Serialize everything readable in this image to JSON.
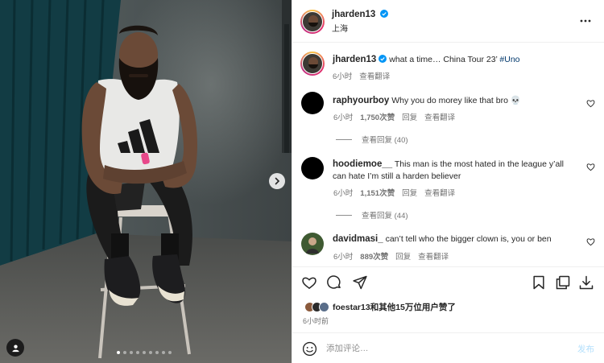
{
  "post": {
    "author": "jharden13",
    "location": "上海",
    "more_icon": "more-horizontal-icon",
    "caption_text": "what a time… China Tour 23’",
    "caption_hashtag": "#Uno",
    "caption_time": "6小时",
    "caption_translate": "查看翻译"
  },
  "comments": [
    {
      "user": "raphyourboy",
      "text": "Why you do morey like that bro 💀",
      "time": "6小时",
      "likes": "1,750次赞",
      "reply": "回复",
      "translate": "查看翻译",
      "view_replies": "查看回复 (40)"
    },
    {
      "user": "hoodiemoe__",
      "text": "This man is the most hated in the league y’all can hate I’m still a harden believer",
      "time": "6小时",
      "likes": "1,151次赞",
      "reply": "回复",
      "translate": "查看翻译",
      "view_replies": "查看回复 (44)"
    },
    {
      "user": "davidmasi_",
      "text": "can’t tell who the bigger clown is, you or ben",
      "time": "6小时",
      "likes": "889次赞",
      "reply": "回复",
      "translate": "查看翻译"
    }
  ],
  "likes": {
    "text": "foestar13和其他15万位用户赞了",
    "time": "6小时前"
  },
  "comment_box": {
    "placeholder": "添加评论…",
    "post_label": "发布"
  },
  "carousel": {
    "total": 9,
    "active": 0
  },
  "colors": {
    "accent": "#0095f6",
    "link": "#00376b",
    "muted": "#737373",
    "border": "#efefef"
  }
}
